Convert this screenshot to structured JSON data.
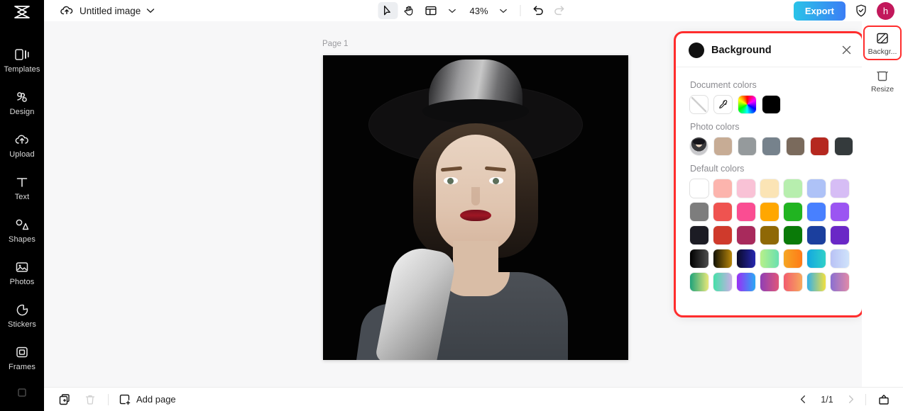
{
  "app": {
    "name": "CapCut",
    "logo_icon": "capcut-logo-icon"
  },
  "topbar": {
    "cloud_icon": "cloud-sync-icon",
    "doc_title": "Untitled image",
    "title_chevron_icon": "chevron-down-icon",
    "tools": [
      {
        "name": "select-tool",
        "icon": "cursor-arrow-icon",
        "active": true
      },
      {
        "name": "hand-tool",
        "icon": "hand-icon",
        "active": false
      },
      {
        "name": "layout-tool",
        "icon": "layout-panels-icon",
        "active": false
      },
      {
        "name": "layout-dropdown",
        "icon": "chevron-down-icon",
        "active": false
      }
    ],
    "zoom_value": "43%",
    "zoom_chevron_icon": "chevron-down-icon",
    "undo_icon": "undo-arrow-icon",
    "redo_icon": "redo-arrow-icon",
    "export_label": "Export",
    "shield_icon": "shield-check-icon",
    "avatar_initial": "h",
    "avatar_color": "#c2185b",
    "export_gradient_from": "#2ac3e8",
    "export_gradient_to": "#3b7ef5"
  },
  "sidebar": {
    "items": [
      {
        "label": "Templates",
        "icon": "templates-icon"
      },
      {
        "label": "Design",
        "icon": "design-icon"
      },
      {
        "label": "Upload",
        "icon": "upload-cloud-icon"
      },
      {
        "label": "Text",
        "icon": "text-t-icon"
      },
      {
        "label": "Shapes",
        "icon": "shapes-icon"
      },
      {
        "label": "Photos",
        "icon": "photo-image-icon"
      },
      {
        "label": "Stickers",
        "icon": "sticker-icon"
      },
      {
        "label": "Frames",
        "icon": "frame-icon"
      }
    ],
    "collapse_handle": "sidebar-collapse-handle"
  },
  "canvas": {
    "page_label": "Page 1",
    "artboard_background": "#000000"
  },
  "background_panel": {
    "title": "Background",
    "swatch_preview_color": "#111111",
    "close_icon": "close-x-icon",
    "sections": {
      "document_colors": {
        "label": "Document colors",
        "swatches": [
          {
            "name": "no-color-swatch",
            "type": "none",
            "color": "#ffffff"
          },
          {
            "name": "eyedropper-swatch",
            "type": "picker",
            "icon": "eyedropper-icon"
          },
          {
            "name": "color-wheel-swatch",
            "type": "wheel"
          },
          {
            "name": "black-swatch",
            "type": "solid",
            "color": "#000000"
          }
        ]
      },
      "photo_colors": {
        "label": "Photo colors",
        "swatches": [
          {
            "name": "photo-thumbnail-swatch",
            "type": "photo"
          },
          {
            "name": "photo-color-swatch",
            "type": "solid",
            "color": "#c7ac95"
          },
          {
            "name": "photo-color-swatch",
            "type": "solid",
            "color": "#959a9c"
          },
          {
            "name": "photo-color-swatch",
            "type": "solid",
            "color": "#76828c"
          },
          {
            "name": "photo-color-swatch",
            "type": "solid",
            "color": "#7a6a5c"
          },
          {
            "name": "photo-color-swatch",
            "type": "solid",
            "color": "#b5281f"
          },
          {
            "name": "photo-color-swatch",
            "type": "solid",
            "color": "#343a3c"
          }
        ]
      },
      "default_colors": {
        "label": "Default colors",
        "rows": [
          [
            "#ffffff",
            "#fcb4ad",
            "#f9c2d6",
            "#fbe4b5",
            "#b7eeae",
            "#aec2f7",
            "#d6bdf5"
          ],
          [
            "#7d7d7d",
            "#ef5350",
            "#fa4d92",
            "#ffa700",
            "#21b421",
            "#4880ff",
            "#9b55f2"
          ],
          [
            "#1c1c24",
            "#cf3a2c",
            "#a82a5c",
            "#8f6806",
            "#0a7a08",
            "#1b3f9e",
            "#6a28c6"
          ],
          [
            "linear-gradient(90deg,#000000,#4d4d4d)",
            "linear-gradient(90deg,#111104,#b8860b)",
            "linear-gradient(90deg,#0a0a28,#2626b0)",
            "linear-gradient(90deg,#b8f08a,#69e0b0)",
            "linear-gradient(90deg,#f5a623,#ff7a18)",
            "linear-gradient(90deg,#13a7e0,#31d0c9)",
            "linear-gradient(90deg,#b9c2f5,#cfe3fb)"
          ],
          [
            "linear-gradient(90deg,#1fa37a,#e8e87a)",
            "linear-gradient(90deg,#45e0a8,#c9aee6)",
            "linear-gradient(90deg,#9a2ef5,#2aa8f5)",
            "linear-gradient(90deg,#8f3fb5,#e0557a)",
            "linear-gradient(90deg,#f25c6e,#f7a85c)",
            "linear-gradient(90deg,#34b0e8,#f2e040)",
            "linear-gradient(90deg,#8a6fd1,#e08aa8)"
          ]
        ]
      }
    }
  },
  "right_rail": {
    "items": [
      {
        "label": "Backgr...",
        "icon": "background-pattern-icon",
        "selected": true
      },
      {
        "label": "Resize",
        "icon": "resize-crop-icon",
        "selected": false
      }
    ]
  },
  "bottombar": {
    "duplicate_icon": "duplicate-page-icon",
    "delete_icon": "trash-bin-icon",
    "add_page_icon": "add-page-icon",
    "add_page_label": "Add page",
    "prev_icon": "chevron-left-icon",
    "next_icon": "chevron-right-icon",
    "page_indicator": "1/1",
    "timeline_icon": "present-timeline-icon"
  }
}
